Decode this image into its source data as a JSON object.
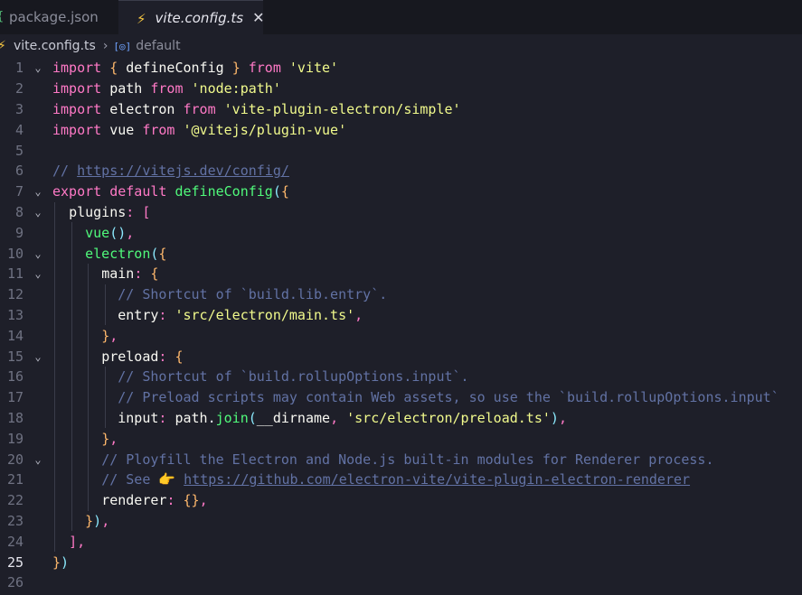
{
  "tabs": [
    {
      "label": "package.json",
      "icon": "json-file-icon",
      "active": false
    },
    {
      "label": "vite.config.ts",
      "icon": "lightning-icon",
      "active": true,
      "close": "✕"
    }
  ],
  "breadcrumb": {
    "file": "vite.config.ts",
    "symbol": "default",
    "symbol_icon": "variable-icon"
  },
  "line_numbers": [
    "1",
    "2",
    "3",
    "4",
    "5",
    "6",
    "7",
    "8",
    "9",
    "10",
    "11",
    "12",
    "13",
    "14",
    "15",
    "16",
    "17",
    "18",
    "19",
    "20",
    "21",
    "22",
    "23",
    "24",
    "25",
    "26"
  ],
  "code_lines": [
    "import { defineConfig } from 'vite'",
    "import path from 'node:path'",
    "import electron from 'vite-plugin-electron/simple'",
    "import vue from '@vitejs/plugin-vue'",
    "",
    "// https://vitejs.dev/config/",
    "export default defineConfig({",
    "  plugins: [",
    "    vue(),",
    "    electron({",
    "      main: {",
    "        // Shortcut of `build.lib.entry`.",
    "        entry: 'src/electron/main.ts',",
    "      },",
    "      preload: {",
    "        // Shortcut of `build.rollupOptions.input`.",
    "        // Preload scripts may contain Web assets, so use the `build.rollupOptions.input`",
    "        input: path.join(__dirname, 'src/electron/preload.ts'),",
    "      },",
    "      // Ployfill the Electron and Node.js built-in modules for Renderer process.",
    "      // See 👉 https://github.com/electron-vite/vite-plugin-electron-renderer",
    "      renderer: {},",
    "    }),",
    "  ],",
    "})",
    ""
  ],
  "current_line": "25",
  "colors": {
    "keyword": "#ff79c6",
    "string": "#f1fa8c",
    "function": "#50fa7b",
    "comment": "#6272a4",
    "background": "#1e1f29"
  }
}
